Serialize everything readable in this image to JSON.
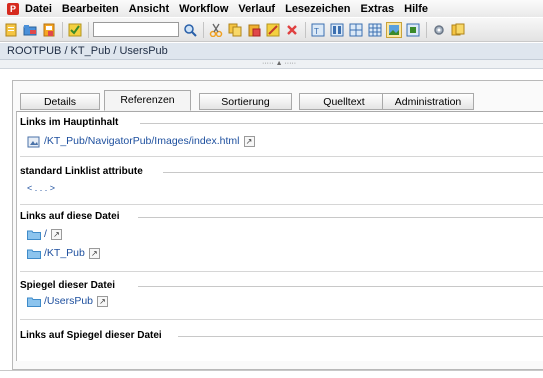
{
  "menubar": {
    "items": [
      "Datei",
      "Bearbeiten",
      "Ansicht",
      "Workflow",
      "Verlauf",
      "Lesezeichen",
      "Extras",
      "Hilfe"
    ]
  },
  "toolbar": {
    "search_value": "",
    "icons": [
      "new-icon",
      "open-icon",
      "save-icon",
      "check-icon",
      "search-icon",
      "cut-icon",
      "copy-icon",
      "paste-icon",
      "edit-icon",
      "delete-icon",
      "text-icon",
      "columns-icon",
      "grid-icon",
      "table-icon",
      "image-icon",
      "media-icon",
      "settings-icon",
      "pages-icon"
    ]
  },
  "breadcrumb": "ROOTPUB / KT_Pub / UsersPub",
  "tabs": [
    {
      "label": "Details",
      "active": false
    },
    {
      "label": "Referenzen",
      "active": true
    },
    {
      "label": "Sortierung",
      "active": false
    },
    {
      "label": "Quelltext",
      "active": false
    },
    {
      "label": "Administration",
      "active": false
    }
  ],
  "sections": {
    "hauptinhalt": {
      "title": "Links im Hauptinhalt",
      "link": "/KT_Pub/NavigatorPub/Images/index.html"
    },
    "linklist": {
      "title": "standard Linklist attribute",
      "placeholder": "< . . . >"
    },
    "links_auf_datei": {
      "title": "Links auf diese Datei",
      "items": [
        "/",
        "/KT_Pub"
      ]
    },
    "spiegel": {
      "title": "Spiegel dieser Datei",
      "items": [
        "/UsersPub"
      ]
    },
    "links_auf_spiegel": {
      "title": "Links auf Spiegel dieser Datei"
    }
  },
  "colors": {
    "accent": "#1d4f9e",
    "folder": "#4aa3df",
    "logo": "#d62a1e",
    "breadcrumb_bg": "#dfe6ee"
  }
}
